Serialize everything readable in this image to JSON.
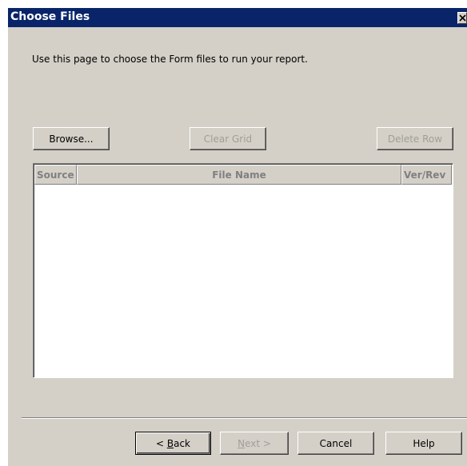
{
  "window": {
    "title": "Choose Files"
  },
  "description": "Use this page to choose the Form files to run your report.",
  "toolbar": {
    "browse_label": "Browse...",
    "clear_grid_label": "Clear Grid",
    "delete_row_label": "Delete Row"
  },
  "grid": {
    "columns": [
      "Source",
      "File Name",
      "Ver/Rev"
    ],
    "rows": []
  },
  "footer": {
    "back_prefix": "< ",
    "back_mnemonic": "B",
    "back_rest": "ack",
    "next_mnemonic": "N",
    "next_rest": "ext >",
    "cancel_label": "Cancel",
    "help_label": "Help"
  },
  "icons": {
    "close": "close-icon"
  }
}
